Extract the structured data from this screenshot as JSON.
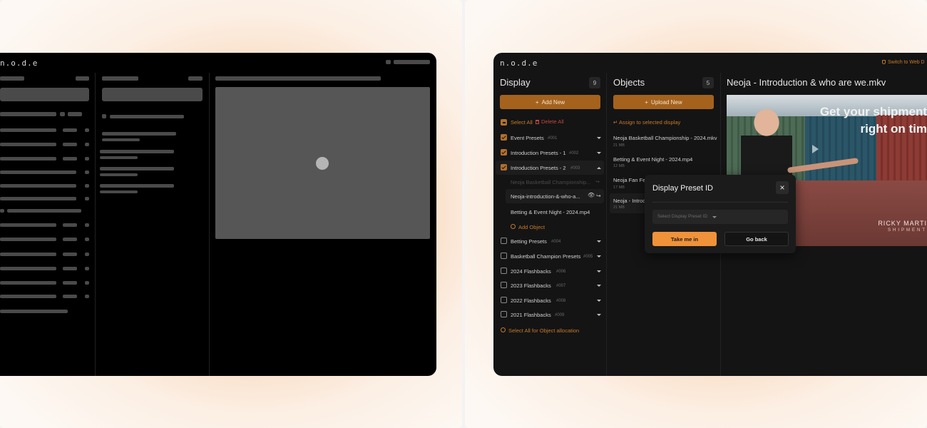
{
  "left": {
    "logo": "n.o.d.e"
  },
  "app": {
    "logo": "n.o.d.e",
    "switch_link": "Switch to Web D",
    "display": {
      "title": "Display",
      "count": "9",
      "add_label": "Add New",
      "select_all": "Select All",
      "delete_all": "Delete All",
      "presets": [
        {
          "label": "Event Presets",
          "id": "#001",
          "checked": true
        },
        {
          "label": "Introduction Presets - 1",
          "id": "#002",
          "checked": true
        },
        {
          "label": "Introduction Presets - 2",
          "id": "#003",
          "checked": true,
          "expanded": true
        }
      ],
      "objects": [
        "Neoja Basketball Championship...",
        "Neoja-introduction-&-who-a...",
        "Betting & Event Night - 2024.mp4"
      ],
      "add_object": "Add Object",
      "more_presets": [
        {
          "label": "Betting Presets",
          "id": "#004"
        },
        {
          "label": "Basketball Champion Presets",
          "id": "#005"
        },
        {
          "label": "2024 Flashbacks",
          "id": "#006"
        },
        {
          "label": "2023 Flashbacks",
          "id": "#007"
        },
        {
          "label": "2022 Flashbacks",
          "id": "#008"
        },
        {
          "label": "2021 Flashbacks",
          "id": "#009"
        }
      ],
      "select_all_allocation": "Select All for Object allocation"
    },
    "objects": {
      "title": "Objects",
      "count": "5",
      "upload_label": "Upload New",
      "assign": "Assign to selected display",
      "files": [
        {
          "name": "Neoja Basketball Championship - 2024.mkv",
          "size": "21 MB"
        },
        {
          "name": "Betting & Event Night - 2024.mp4",
          "size": "12 MB"
        },
        {
          "name": "Neoja Fan Fes",
          "size": "17 MB"
        },
        {
          "name": "Neoja - Introd",
          "size": "21 MB"
        }
      ]
    },
    "preview": {
      "title": "Neoja - Introduction & who are we.mkv",
      "headline_1": "Get your shipment",
      "headline_2": "right on tim",
      "brand": "RICKY MARTI",
      "brand_sub": "SHIPMENT"
    },
    "modal": {
      "title": "Display Preset ID",
      "select_placeholder": "Select Display Preset ID",
      "confirm": "Take me in",
      "back": "Go back"
    }
  },
  "colors": {
    "accent": "#c47a2c",
    "button": "#a4621d",
    "danger": "#c0473e",
    "confirm": "#f0923a"
  }
}
